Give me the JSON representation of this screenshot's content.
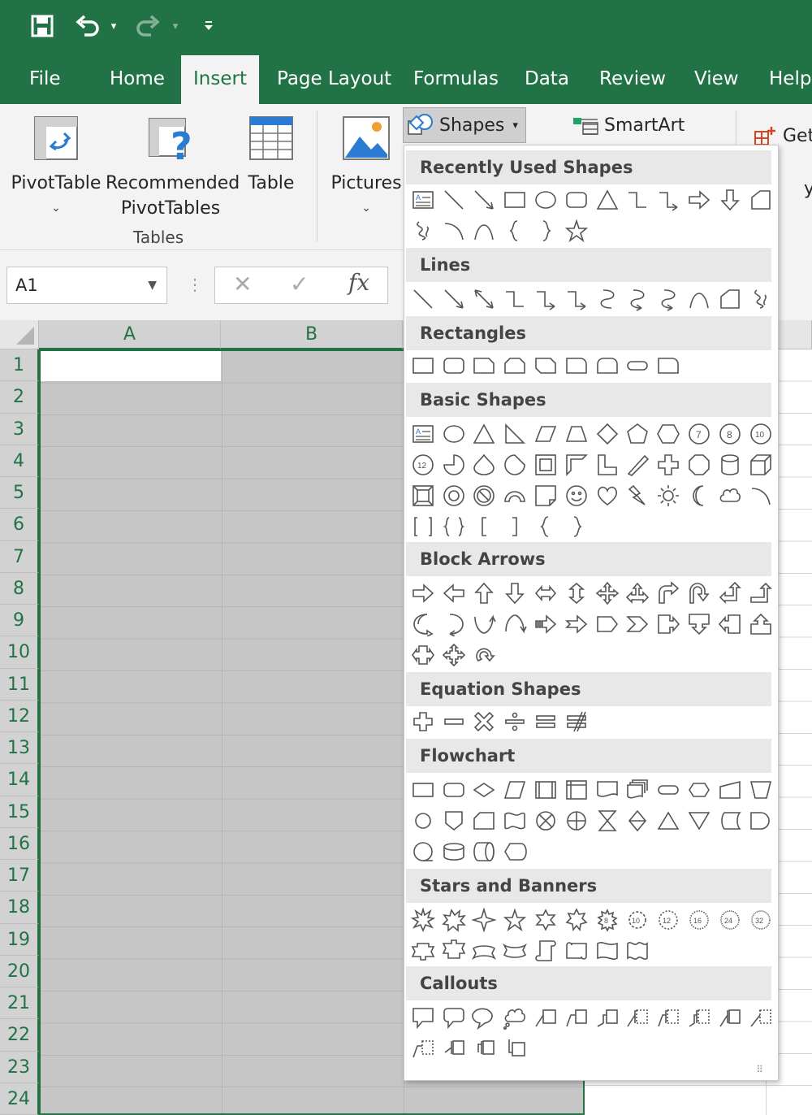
{
  "quick_access": {
    "save_icon": "save-icon",
    "undo_icon": "undo-icon",
    "redo_icon": "redo-icon",
    "customize_icon": "customize-qat-icon"
  },
  "tabs": [
    {
      "label": "File"
    },
    {
      "label": "Home"
    },
    {
      "label": "Insert"
    },
    {
      "label": "Page Layout"
    },
    {
      "label": "Formulas"
    },
    {
      "label": "Data"
    },
    {
      "label": "Review"
    },
    {
      "label": "View"
    },
    {
      "label": "Help"
    }
  ],
  "ribbon": {
    "pivot_line1": "PivotTable",
    "recommended_line1": "Recommended",
    "recommended_line2": "PivotTables",
    "table_label": "Table",
    "tables_group": "Tables",
    "pictures_label": "Pictures",
    "shapes_label": "Shapes",
    "smartart_label": "SmartArt",
    "get_label": "Get",
    "cut_letter": "y"
  },
  "formula_bar": {
    "name_box": "A1",
    "fx": "fx"
  },
  "grid": {
    "columns": [
      "A",
      "B"
    ],
    "rows": [
      "1",
      "2",
      "3",
      "4",
      "5",
      "6",
      "7",
      "8",
      "9",
      "10",
      "11",
      "12",
      "13",
      "14",
      "15",
      "16",
      "17",
      "18",
      "19",
      "20",
      "21",
      "22",
      "23",
      "24"
    ]
  },
  "shapes_menu": {
    "sections": [
      {
        "title": "Recently Used Shapes"
      },
      {
        "title": "Lines"
      },
      {
        "title": "Rectangles"
      },
      {
        "title": "Basic Shapes"
      },
      {
        "title": "Block Arrows"
      },
      {
        "title": "Equation Shapes"
      },
      {
        "title": "Flowchart"
      },
      {
        "title": "Stars and Banners"
      },
      {
        "title": "Callouts"
      }
    ]
  },
  "colors": {
    "excel_green": "#217346",
    "ribbon_bg": "#f3f3f3",
    "selection_gray": "#c6c6c6"
  }
}
